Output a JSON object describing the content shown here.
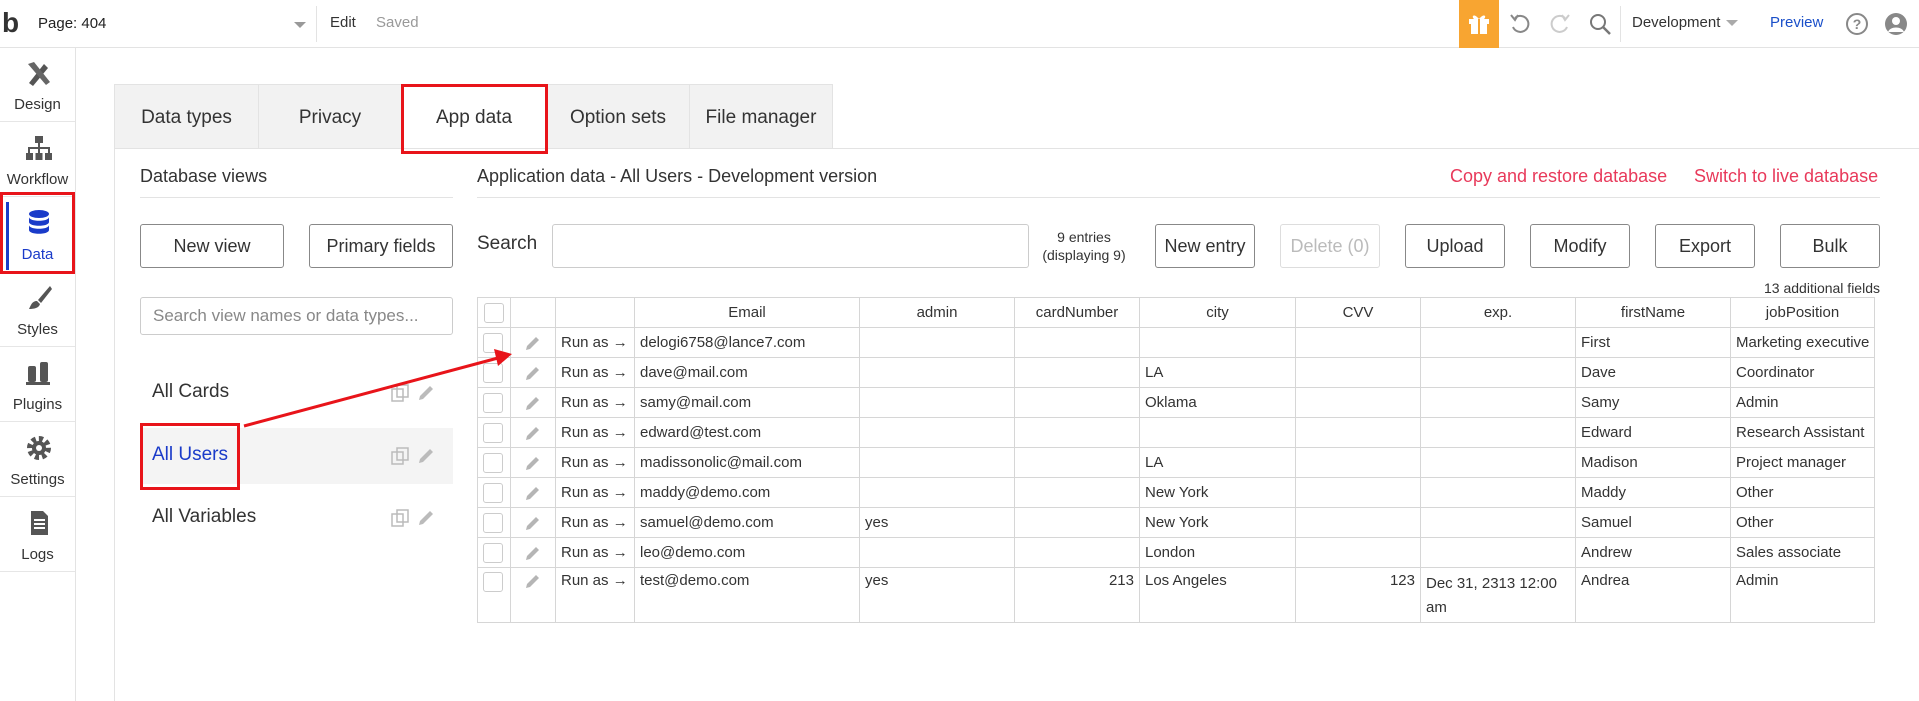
{
  "topbar": {
    "logo": "b",
    "page_label": "Page: 404",
    "edit": "Edit",
    "saved": "Saved",
    "environment": "Development",
    "preview": "Preview"
  },
  "leftnav": [
    {
      "label": "Design",
      "icon": "design-icon"
    },
    {
      "label": "Workflow",
      "icon": "workflow-icon"
    },
    {
      "label": "Data",
      "icon": "database-icon",
      "active": true
    },
    {
      "label": "Styles",
      "icon": "brush-icon"
    },
    {
      "label": "Plugins",
      "icon": "plug-icon"
    },
    {
      "label": "Settings",
      "icon": "gear-icon"
    },
    {
      "label": "Logs",
      "icon": "document-icon"
    }
  ],
  "tabs": [
    "Data types",
    "Privacy",
    "App data",
    "Option sets",
    "File manager"
  ],
  "db_views": {
    "title": "Database views",
    "new_view": "New view",
    "primary_fields": "Primary fields",
    "search_placeholder": "Search view names or data types...",
    "items": [
      "All Cards",
      "All Users",
      "All Variables"
    ]
  },
  "app_data": {
    "title": "Application data - All Users - Development version",
    "copy_restore": "Copy and restore database",
    "switch_live": "Switch to live database",
    "search_label": "Search",
    "entries_line1": "9 entries",
    "entries_line2": "(displaying 9)",
    "buttons": {
      "new_entry": "New entry",
      "delete": "Delete (0)",
      "upload": "Upload",
      "modify": "Modify",
      "export": "Export",
      "bulk": "Bulk"
    },
    "additional_fields": "13 additional fields",
    "run_as": "Run as →",
    "columns": [
      "Email",
      "admin",
      "cardNumber",
      "city",
      "CVV",
      "exp.",
      "firstName",
      "jobPosition"
    ],
    "rows": [
      [
        "delogi6758@lance7.com",
        "",
        "",
        "",
        "",
        "",
        "First",
        "Marketing executive"
      ],
      [
        "dave@mail.com",
        "",
        "",
        "LA",
        "",
        "",
        "Dave",
        "Coordinator"
      ],
      [
        "samy@mail.com",
        "",
        "",
        "Oklama",
        "",
        "",
        "Samy",
        "Admin"
      ],
      [
        "edward@test.com",
        "",
        "",
        "",
        "",
        "",
        "Edward",
        "Research Assistant"
      ],
      [
        "madissonolic@mail.com",
        "",
        "",
        "LA",
        "",
        "",
        "Madison",
        "Project manager"
      ],
      [
        "maddy@demo.com",
        "",
        "",
        "New York",
        "",
        "",
        "Maddy",
        "Other"
      ],
      [
        "samuel@demo.com",
        "yes",
        "",
        "New York",
        "",
        "",
        "Samuel",
        "Other"
      ],
      [
        "leo@demo.com",
        "",
        "",
        "London",
        "",
        "",
        "Andrew",
        "Sales associate"
      ],
      [
        "test@demo.com",
        "yes",
        "213",
        "Los Angeles",
        "123",
        "Dec 31, 2313 12:00 am",
        "Andrea",
        "Admin"
      ]
    ]
  },
  "colors": {
    "accent_blue": "#1a3bc9",
    "highlight_red": "#e8141a",
    "link_red": "#e8395a",
    "gift_orange": "#f8a531"
  }
}
